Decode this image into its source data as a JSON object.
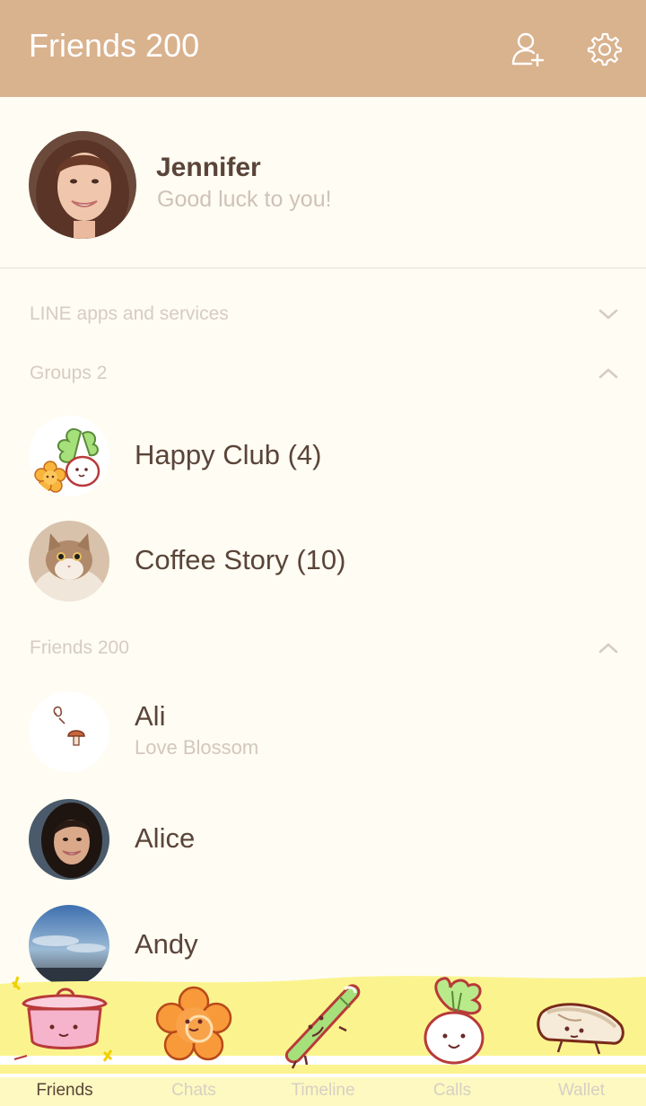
{
  "header": {
    "title": "Friends 200",
    "add_friend_icon": "add-friend-icon",
    "settings_icon": "gear-icon",
    "background": "#d9b28e"
  },
  "profile": {
    "name": "Jennifer",
    "status": "Good luck to you!"
  },
  "sections": {
    "services": {
      "label": "LINE apps and services",
      "expanded": false
    },
    "groups": {
      "label": "Groups 2",
      "expanded": true
    },
    "friends": {
      "label": "Friends 200",
      "expanded": true
    }
  },
  "groups": [
    {
      "name": "Happy Club (4)"
    },
    {
      "name": "Coffee Story (10)"
    }
  ],
  "friends": [
    {
      "name": "Ali",
      "status": "Love Blossom"
    },
    {
      "name": "Alice"
    },
    {
      "name": "Andy"
    }
  ],
  "tabs": [
    {
      "label": "Friends",
      "active": true,
      "icon": "pot-icon"
    },
    {
      "label": "Chats",
      "active": false,
      "icon": "flower-icon"
    },
    {
      "label": "Timeline",
      "active": false,
      "icon": "leek-icon"
    },
    {
      "label": "Calls",
      "active": false,
      "icon": "turnip-icon"
    },
    {
      "label": "Wallet",
      "active": false,
      "icon": "bread-icon"
    }
  ],
  "colors": {
    "background": "#fefcf3",
    "text_primary": "#5a4438",
    "text_secondary": "#d3c7bc",
    "tabbar_yellow": "#fbf48e"
  }
}
